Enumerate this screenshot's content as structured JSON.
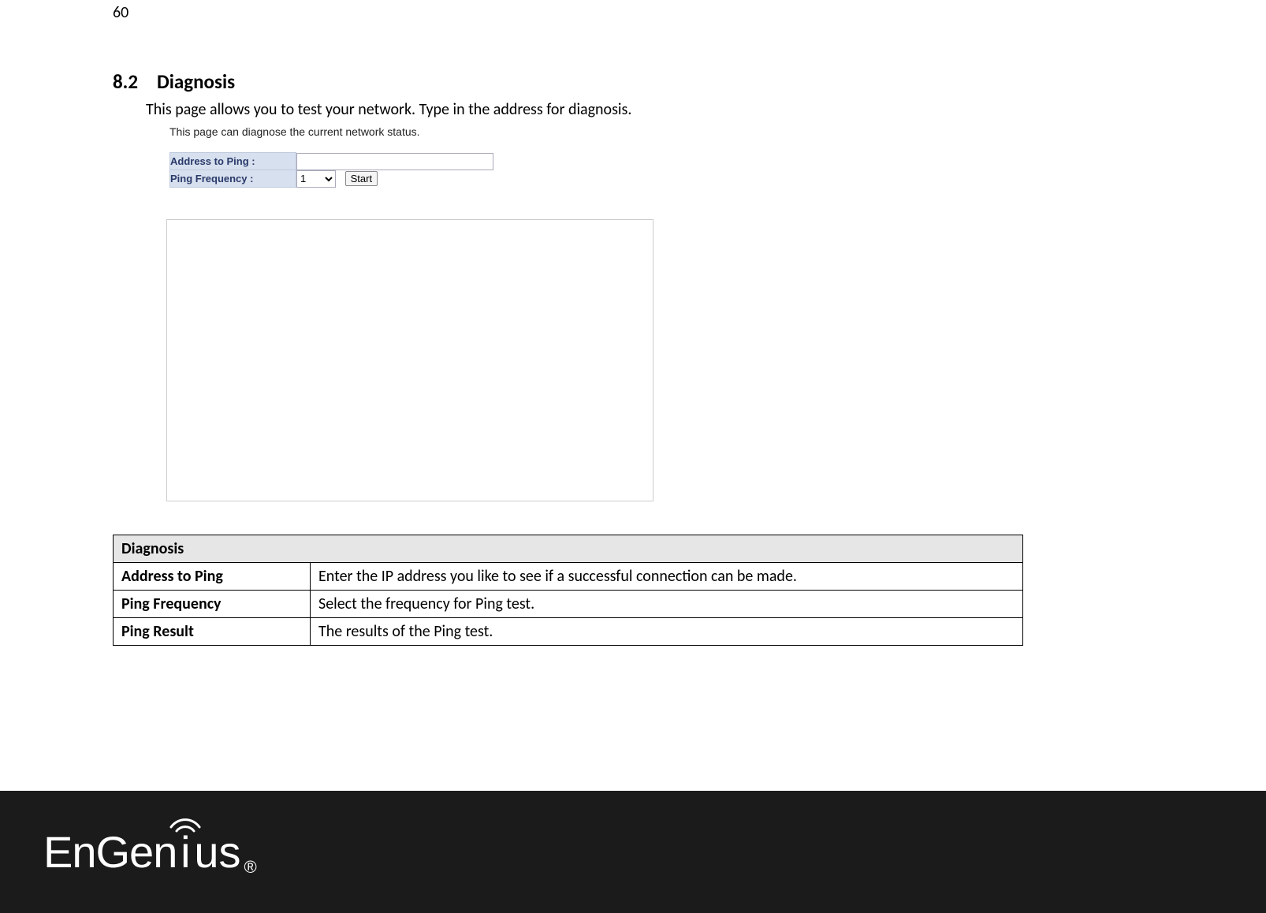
{
  "page_number": "60",
  "section": {
    "number": "8.2",
    "title": "Diagnosis"
  },
  "intro": "This page allows you to test your network. Type in the address for diagnosis.",
  "form": {
    "description": "This page can diagnose the current network status.",
    "address_label": "Address to Ping :",
    "address_value": "",
    "frequency_label": "Ping Frequency :",
    "frequency_value": "1",
    "start_label": "Start",
    "output": ""
  },
  "desc_table": {
    "header": "Diagnosis",
    "rows": [
      {
        "key": "Address to Ping",
        "value": "Enter the IP address you like to see if a successful connection can be made."
      },
      {
        "key": "Ping Frequency",
        "value": "Select the frequency for Ping test."
      },
      {
        "key": "Ping Result",
        "value": "The results of the Ping test."
      }
    ]
  },
  "footer": {
    "brand_part1": "EnGen",
    "brand_dot": "i",
    "brand_part2": "us",
    "reg": "®"
  }
}
